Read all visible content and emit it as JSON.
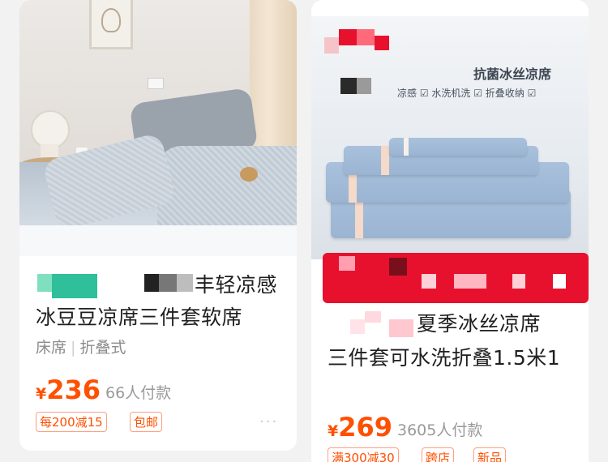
{
  "cards": [
    {
      "title_line1_tail": "丰轻凉感",
      "title_line2": "冰豆豆凉席三件套软席",
      "tags": [
        "床席",
        "折叠式"
      ],
      "currency": "¥",
      "price": "236",
      "sales": "66人付款",
      "badges": [
        "每200减15",
        "包邮"
      ]
    },
    {
      "image_title": "抗菌冰丝凉席",
      "image_features": "凉感 ☑ 水洗机洗 ☑ 折叠收纳 ☑",
      "title_line1_tail": "夏季冰丝凉席",
      "title_line2": "三件套可水洗折叠1.5米1",
      "currency": "¥",
      "price": "269",
      "sales": "3605人付款",
      "badges": [
        "满300减30",
        "跨店",
        "新品"
      ]
    }
  ],
  "more_icon": "···",
  "colors": {
    "price": "#ff4f00",
    "accent_red": "#e8112d"
  }
}
